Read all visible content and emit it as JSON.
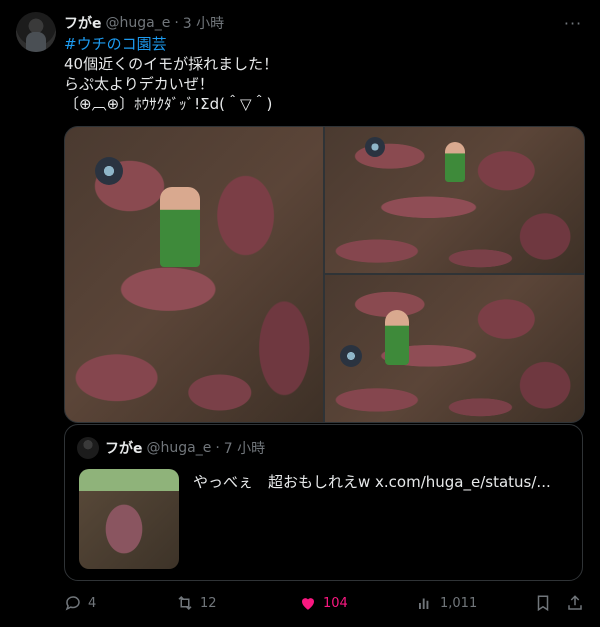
{
  "tweet": {
    "display_name": "フがe",
    "handle": "@huga_e",
    "separator": "·",
    "time": "3 小時",
    "hashtag": "#ウチのコ園芸",
    "lines": [
      "40個近くのイモが採れました！",
      "らぷ太よりデカいぜ！",
      "〔⊕︹⊕〕ﾎｳｻｸﾀﾞｯﾞ!Σd(＾▽＾)"
    ],
    "more_label": "···"
  },
  "quote": {
    "display_name": "フがe",
    "handle": "@huga_e",
    "separator": "·",
    "time": "7 小時",
    "text": "やっべぇ　超おもしれえw x.com/huga_e/status/..."
  },
  "actions": {
    "replies": "4",
    "reposts": "12",
    "likes": "104",
    "views": "1,011"
  },
  "colors": {
    "accent": "#1d9bf0",
    "like": "#f91880",
    "muted": "#71767b"
  }
}
